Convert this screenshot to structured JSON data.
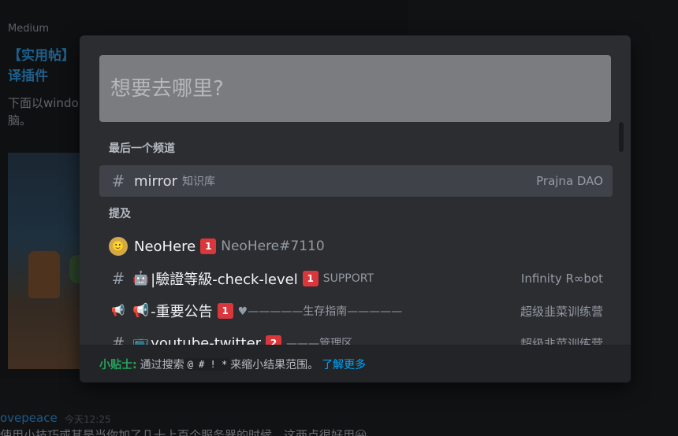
{
  "background": {
    "source": "Medium",
    "title": "【实用帖】译插件",
    "description": "下面以windo脑。",
    "author": "ovepeace",
    "time": "今天12:25",
    "message": "使用小技巧或其是当你加了几十上百个服务器的时候，这两点很好用😀"
  },
  "quick_switcher": {
    "search_placeholder": "想要去哪里?",
    "sections": {
      "last_channel": "最后一个频道",
      "mentions": "提及"
    },
    "last_channel": {
      "channel": "mirror",
      "category": "知识库",
      "server": "Prajna DAO"
    },
    "mentions": [
      {
        "icon": "user-avatar-icon",
        "name": "NeoHere",
        "badge": "1",
        "detail": "NeoHere#7110",
        "server": ""
      },
      {
        "icon": "hash-lock-icon",
        "name": "|驗證等級-check-level",
        "emoji": "🤖",
        "badge": "1",
        "detail": "SUPPORT",
        "server": "Infinity R∞bot"
      },
      {
        "icon": "announcement-icon",
        "name": "-重要公告",
        "emoji": "📢",
        "badge": "1",
        "detail": "♥—————生存指南—————",
        "server": "超级韭菜训练营"
      },
      {
        "icon": "hash-icon",
        "name": "youtube-twitter",
        "emoji": "📺",
        "badge": "2",
        "detail": "———管理区",
        "server": "超级韭菜训练营"
      }
    ],
    "footer": {
      "label": "小贴士:",
      "text_before": "通过搜索",
      "codes": "@ # ! *",
      "text_after": "来缩小结果范围。",
      "link": "了解更多"
    }
  },
  "colors": {
    "mention_badge": "#da373c",
    "tip_green": "#23a55a",
    "link_blue": "#00a8fc"
  }
}
